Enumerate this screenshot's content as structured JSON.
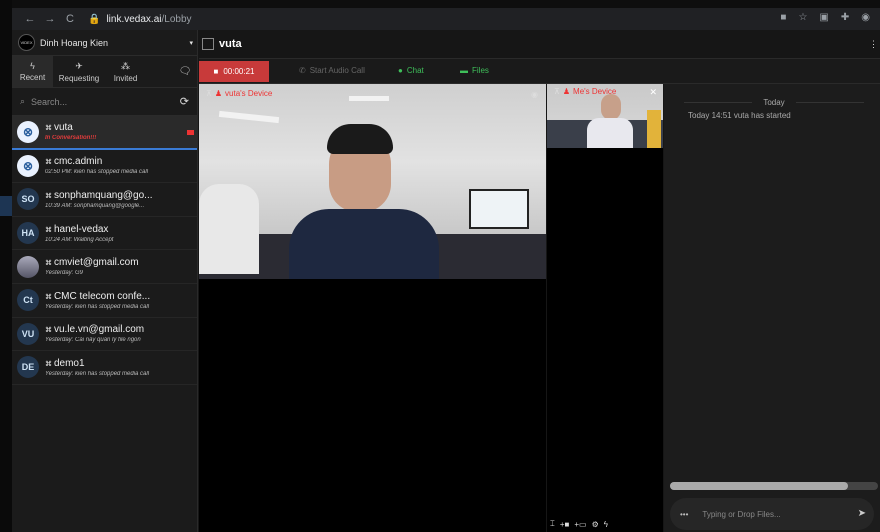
{
  "browser": {
    "url_host": "link.vedax.ai",
    "url_path": "/Lobby",
    "nav": [
      "←",
      "→",
      "C"
    ]
  },
  "user": {
    "name": "Dinh Hoang Kien",
    "logo_text": "VIDEX"
  },
  "tabs": [
    {
      "label": "Recent",
      "icon": "ϟ"
    },
    {
      "label": "Requesting",
      "icon": "✈"
    },
    {
      "label": "Invited",
      "icon": "⁂"
    }
  ],
  "search": {
    "placeholder": "Search..."
  },
  "conversations": [
    {
      "name": "vuta",
      "sub": "In Conversation!!!",
      "avatar": "⊗",
      "kind": "vx",
      "active": true
    },
    {
      "name": "cmc.admin",
      "sub": "02:50 PM: kien has stopped media call",
      "avatar": "⊗",
      "kind": "vx"
    },
    {
      "name": "sonphamquang@go...",
      "sub": "10:39 AM: sonphamquang@google...",
      "avatar": "SO",
      "kind": "txt"
    },
    {
      "name": "hanel-vedax",
      "sub": "10:24 AM: Waiting Accept",
      "avatar": "HA",
      "kind": "txt"
    },
    {
      "name": "cmviet@gmail.com",
      "sub": "Yesterday: G9",
      "avatar": "",
      "kind": "photo"
    },
    {
      "name": "CMC telecom confe...",
      "sub": "Yesterday: kien has stopped media call",
      "avatar": "Ct",
      "kind": "txt"
    },
    {
      "name": "vu.le.vn@gmail.com",
      "sub": "Yesterday: Cái này quản lý file ngon",
      "avatar": "VU",
      "kind": "txt"
    },
    {
      "name": "demo1",
      "sub": "Yesterday: kien has stopped media call",
      "avatar": "DE",
      "kind": "txt"
    }
  ],
  "conversation_title": "vuta",
  "actions": {
    "timer": "00:00:21",
    "start_audio": "Start Audio Call",
    "chat": "Chat",
    "files": "Files"
  },
  "videos": {
    "main_label": "vuta's Device",
    "self_label": "Me's Device"
  },
  "chat_panel": {
    "day": "Today",
    "system_msg": "Today 14:51  vuta has started",
    "input_placeholder": "Typing or Drop Files...",
    "more": "•••"
  },
  "colors": {
    "accent_red": "#e23c3c",
    "accent_green": "#3fbf5a",
    "accent_blue": "#3a7bd5"
  }
}
